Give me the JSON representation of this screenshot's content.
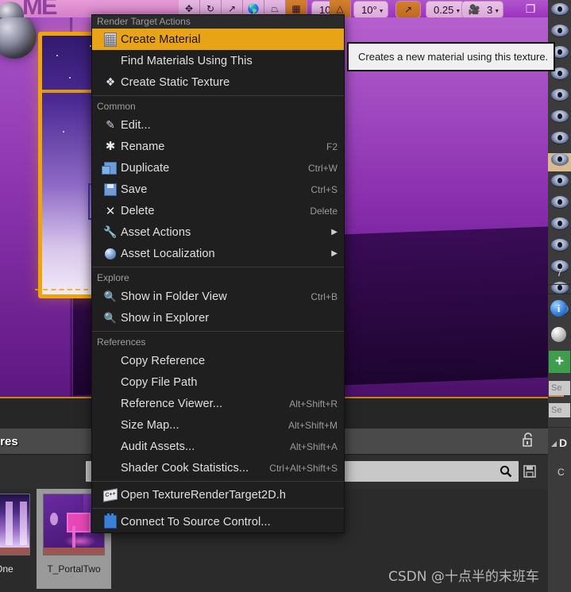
{
  "toolbar": {
    "items": [
      {
        "name": "move-tool",
        "icon": "move-icon",
        "label": ""
      },
      {
        "name": "rotate-tool",
        "icon": "rotate-icon",
        "label": ""
      },
      {
        "name": "scale-tool",
        "icon": "scale-icon",
        "label": ""
      },
      {
        "name": "world-coords",
        "icon": "globe-icon",
        "label": ""
      },
      {
        "name": "snap-transform",
        "icon": "transform-icon",
        "label": ""
      },
      {
        "name": "surface-snap",
        "icon": "grid-icon",
        "label": "",
        "active": true
      }
    ],
    "grid_snap_value": "10",
    "angle_snap_value": "10°",
    "scale_snap_value": "0.25",
    "camera_speed_value": "3",
    "maximize_label": ""
  },
  "menu": {
    "header": "Render Target Actions",
    "sections": [
      {
        "title": "",
        "items": [
          {
            "label": "Create Material",
            "icon": "material-icon",
            "shortcut": "",
            "highlighted": true,
            "submenu": false
          },
          {
            "label": "Find Materials Using This",
            "icon": "",
            "shortcut": "",
            "highlighted": false,
            "submenu": false
          },
          {
            "label": "Create Static Texture",
            "icon": "static-texture-icon",
            "shortcut": "",
            "highlighted": false,
            "submenu": false
          }
        ]
      },
      {
        "title": "Common",
        "items": [
          {
            "label": "Edit...",
            "icon": "edit-icon",
            "shortcut": "",
            "highlighted": false,
            "submenu": false
          },
          {
            "label": "Rename",
            "icon": "rename-icon",
            "shortcut": "F2",
            "highlighted": false,
            "submenu": false
          },
          {
            "label": "Duplicate",
            "icon": "duplicate-icon",
            "shortcut": "Ctrl+W",
            "highlighted": false,
            "submenu": false
          },
          {
            "label": "Save",
            "icon": "save-icon",
            "shortcut": "Ctrl+S",
            "highlighted": false,
            "submenu": false
          },
          {
            "label": "Delete",
            "icon": "delete-icon",
            "shortcut": "Delete",
            "highlighted": false,
            "submenu": false
          },
          {
            "label": "Asset Actions",
            "icon": "wrench-icon",
            "shortcut": "",
            "highlighted": false,
            "submenu": true
          },
          {
            "label": "Asset Localization",
            "icon": "globe-icon",
            "shortcut": "",
            "highlighted": false,
            "submenu": true
          }
        ]
      },
      {
        "title": "Explore",
        "items": [
          {
            "label": "Show in Folder View",
            "icon": "search-icon",
            "shortcut": "Ctrl+B",
            "highlighted": false,
            "submenu": false
          },
          {
            "label": "Show in Explorer",
            "icon": "search-icon",
            "shortcut": "",
            "highlighted": false,
            "submenu": false
          }
        ]
      },
      {
        "title": "References",
        "items": [
          {
            "label": "Copy Reference",
            "icon": "",
            "shortcut": "",
            "highlighted": false,
            "submenu": false
          },
          {
            "label": "Copy File Path",
            "icon": "",
            "shortcut": "",
            "highlighted": false,
            "submenu": false
          },
          {
            "label": "Reference Viewer...",
            "icon": "",
            "shortcut": "Alt+Shift+R",
            "highlighted": false,
            "submenu": false
          },
          {
            "label": "Size Map...",
            "icon": "",
            "shortcut": "Alt+Shift+M",
            "highlighted": false,
            "submenu": false
          },
          {
            "label": "Audit Assets...",
            "icon": "",
            "shortcut": "Alt+Shift+A",
            "highlighted": false,
            "submenu": false
          },
          {
            "label": "Shader Cook Statistics...",
            "icon": "",
            "shortcut": "Ctrl+Alt+Shift+S",
            "highlighted": false,
            "submenu": false
          }
        ]
      },
      {
        "title": "",
        "items": [
          {
            "label": "Open TextureRenderTarget2D.h",
            "icon": "cpp-icon",
            "shortcut": "",
            "highlighted": false,
            "submenu": false
          }
        ]
      },
      {
        "title": "",
        "items": [
          {
            "label": "Connect To Source Control...",
            "icon": "source-control-icon",
            "shortcut": "",
            "highlighted": false,
            "submenu": false
          }
        ]
      }
    ],
    "highlight_color": "#e8a317"
  },
  "tooltip": {
    "text": "Creates a new material using this texture."
  },
  "content_browser": {
    "tab_label": "tures",
    "search_placeholder": "",
    "items": [
      {
        "label": "talOne",
        "selected": false
      },
      {
        "label": "T_PortalTwo",
        "selected": true
      }
    ]
  },
  "right_rail": {
    "count_label": "7",
    "info_glyph": "i",
    "add_label": "+",
    "field_one": "Se",
    "field_two": "Se",
    "detail_label": "D",
    "detail_sub": "C"
  },
  "watermark": {
    "text": "CSDN @十点半的末班车"
  }
}
